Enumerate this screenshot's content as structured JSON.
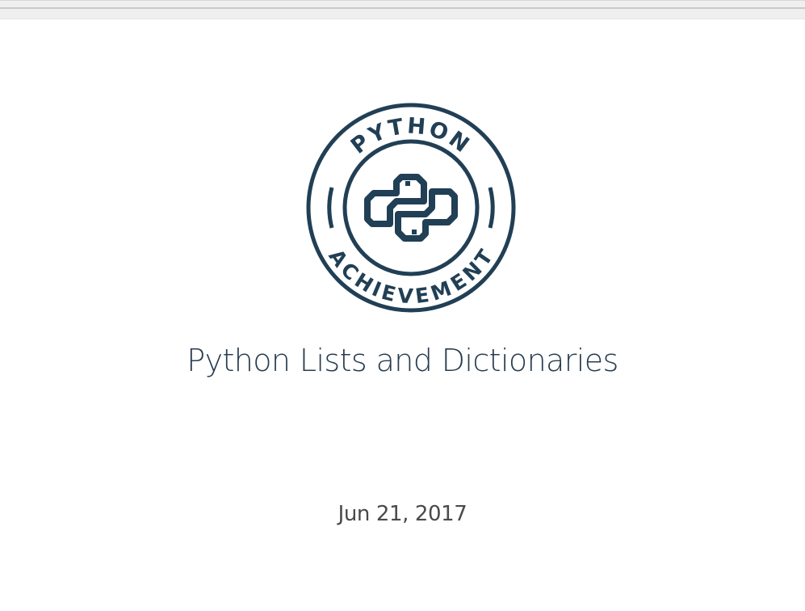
{
  "badge": {
    "top_text": "PYTHON",
    "bottom_text": "ACHIEVEMENT",
    "icon": "python-logo-icon",
    "color": "#213f55"
  },
  "certificate": {
    "title": "Python Lists and Dictionaries",
    "date": "Jun 21, 2017"
  }
}
